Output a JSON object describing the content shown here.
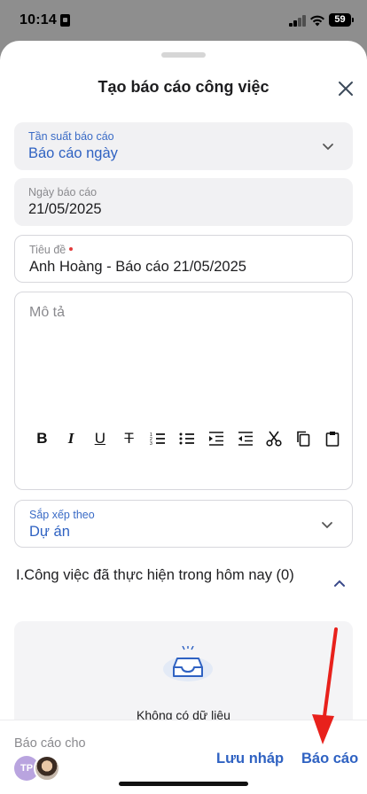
{
  "status_bar": {
    "time": "10:14",
    "battery": "59"
  },
  "sheet": {
    "title": "Tạo báo cáo công việc",
    "fields": {
      "frequency": {
        "label": "Tần suất báo cáo",
        "value": "Báo cáo ngày"
      },
      "date": {
        "label": "Ngày báo cáo",
        "value": "21/05/2025"
      },
      "subject": {
        "label": "Tiêu đề",
        "value": "Anh Hoàng - Báo cáo 21/05/2025"
      },
      "description": {
        "placeholder": "Mô tả"
      },
      "sort": {
        "label": "Sắp xếp theo",
        "value": "Dự án"
      }
    },
    "toolbar": {
      "bold": "B",
      "italic": "I",
      "underline": "U",
      "strikethrough": "T",
      "buttons": [
        "bold",
        "italic",
        "underline",
        "strikethrough",
        "numbered-list",
        "bullet-list",
        "indent",
        "outdent",
        "cut",
        "copy",
        "paste"
      ]
    },
    "section": {
      "title": "I.Công việc đã thực hiện trong hôm nay (0)"
    },
    "empty_state": {
      "text": "Không có dữ liệu"
    }
  },
  "bottom_bar": {
    "report_to_label": "Báo cáo cho",
    "avatar_initials": "TP",
    "save_draft": "Lưu nháp",
    "submit": "Báo cáo"
  },
  "colors": {
    "accent": "#2f62c2",
    "annotation": "#e8211c"
  }
}
